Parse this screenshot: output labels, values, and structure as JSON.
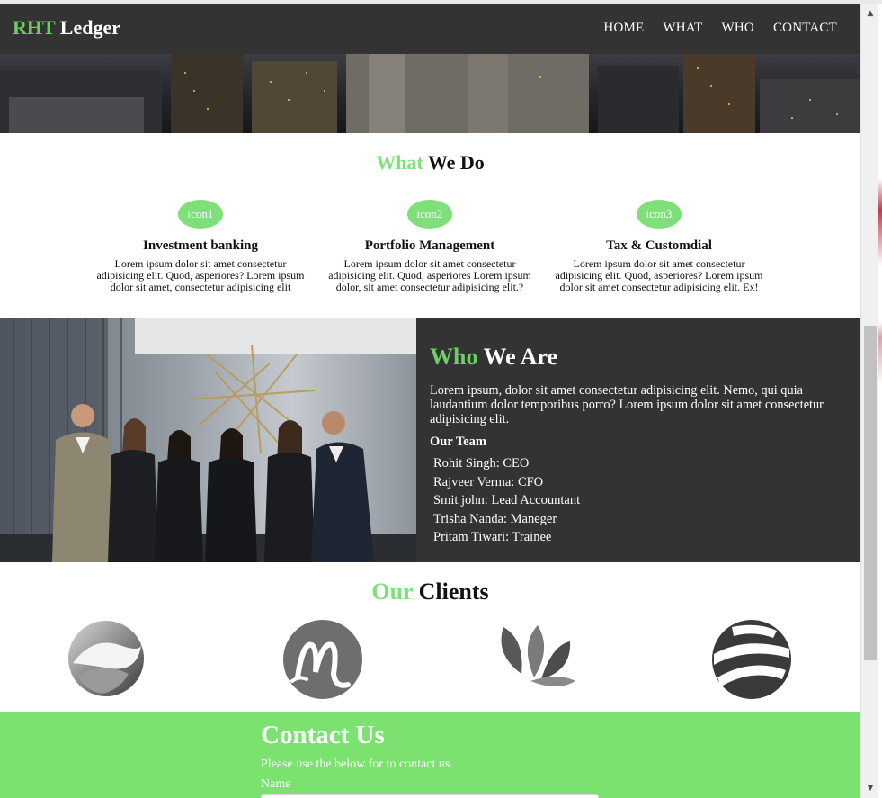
{
  "brand": {
    "accent": "RHT",
    "rest": " Ledger"
  },
  "nav": [
    "HOME",
    "WHAT",
    "WHO",
    "CONTACT"
  ],
  "what": {
    "title_accent": "What",
    "title_rest": " We Do",
    "services": [
      {
        "icon": "icon1",
        "title": "Investment banking",
        "text": "Lorem ipsum dolor sit amet consectetur adipisicing elit. Quod, asperiores? Lorem ipsum dolor sit amet, consectetur adipisicing elit"
      },
      {
        "icon": "icon2",
        "title": "Portfolio Management",
        "text": "Lorem ipsum dolor sit amet consectetur adipisicing elit. Quod, asperiores Lorem ipsum dolor, sit amet consectetur adipisicing elit.?"
      },
      {
        "icon": "icon3",
        "title": "Tax & Customdial",
        "text": "Lorem ipsum dolor sit amet consectetur adipisicing elit. Quod, asperiores? Lorem ipsum dolor sit amet consectetur adipisicing elit. Ex!"
      }
    ]
  },
  "who": {
    "title_accent": "Who",
    "title_rest": " We Are",
    "text": "Lorem ipsum, dolor sit amet consectetur adipisicing elit. Nemo, qui quia laudantium dolor temporibus porro? Lorem ipsum dolor sit amet consectetur adipisicing elit.",
    "team_heading": "Our Team",
    "team": [
      "Rohit Singh: CEO",
      "Rajveer Verma: CFO",
      "Smit john: Lead Accountant",
      "Trisha Nanda: Maneger",
      "Pritam Tiwari: Trainee"
    ]
  },
  "clients": {
    "title_accent": "Our",
    "title_rest": " Clients"
  },
  "contact": {
    "title": "Contact Us",
    "subtitle": "Please use the below for to contact us",
    "name_label": "Name"
  },
  "colors": {
    "accent": "#6ccf66",
    "dark": "#333333",
    "contact_bg": "#7be26f"
  }
}
